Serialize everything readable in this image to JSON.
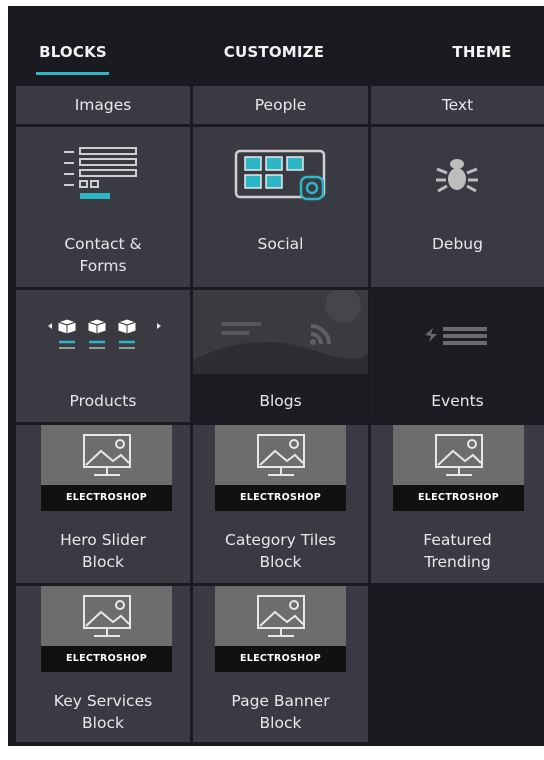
{
  "tabs": [
    {
      "label": "BLOCKS",
      "active": true
    },
    {
      "label": "CUSTOMIZE",
      "active": false
    },
    {
      "label": "THEME",
      "active": false
    }
  ],
  "accent_color": "#2db6c6",
  "categories": [
    {
      "label": "Images",
      "icon": "image-icon"
    },
    {
      "label": "People",
      "icon": "people-icon"
    },
    {
      "label": "Text",
      "icon": "text-icon"
    }
  ],
  "feature_blocks": [
    {
      "label_line1": "Contact &",
      "label_line2": "Forms",
      "icon": "form-icon"
    },
    {
      "label_line1": "Social",
      "label_line2": "",
      "icon": "social-icon"
    },
    {
      "label_line1": "Debug",
      "label_line2": "",
      "icon": "bug-icon"
    },
    {
      "label_line1": "Products",
      "label_line2": "",
      "icon": "products-icon"
    },
    {
      "label_line1": "Blogs",
      "label_line2": "",
      "icon": "rss-icon"
    },
    {
      "label_line1": "Events",
      "label_line2": "",
      "icon": "events-icon"
    }
  ],
  "shop_blocks": [
    {
      "brand": "ELECTROSHOP",
      "label_line1": "Hero Slider",
      "label_line2": "Block"
    },
    {
      "brand": "ELECTROSHOP",
      "label_line1": "Category Tiles",
      "label_line2": "Block"
    },
    {
      "brand": "ELECTROSHOP",
      "label_line1": "Featured",
      "label_line2": "Trending"
    },
    {
      "brand": "ELECTROSHOP",
      "label_line1": "Key Services",
      "label_line2": "Block"
    },
    {
      "brand": "ELECTROSHOP",
      "label_line1": "Page Banner",
      "label_line2": "Block"
    }
  ]
}
